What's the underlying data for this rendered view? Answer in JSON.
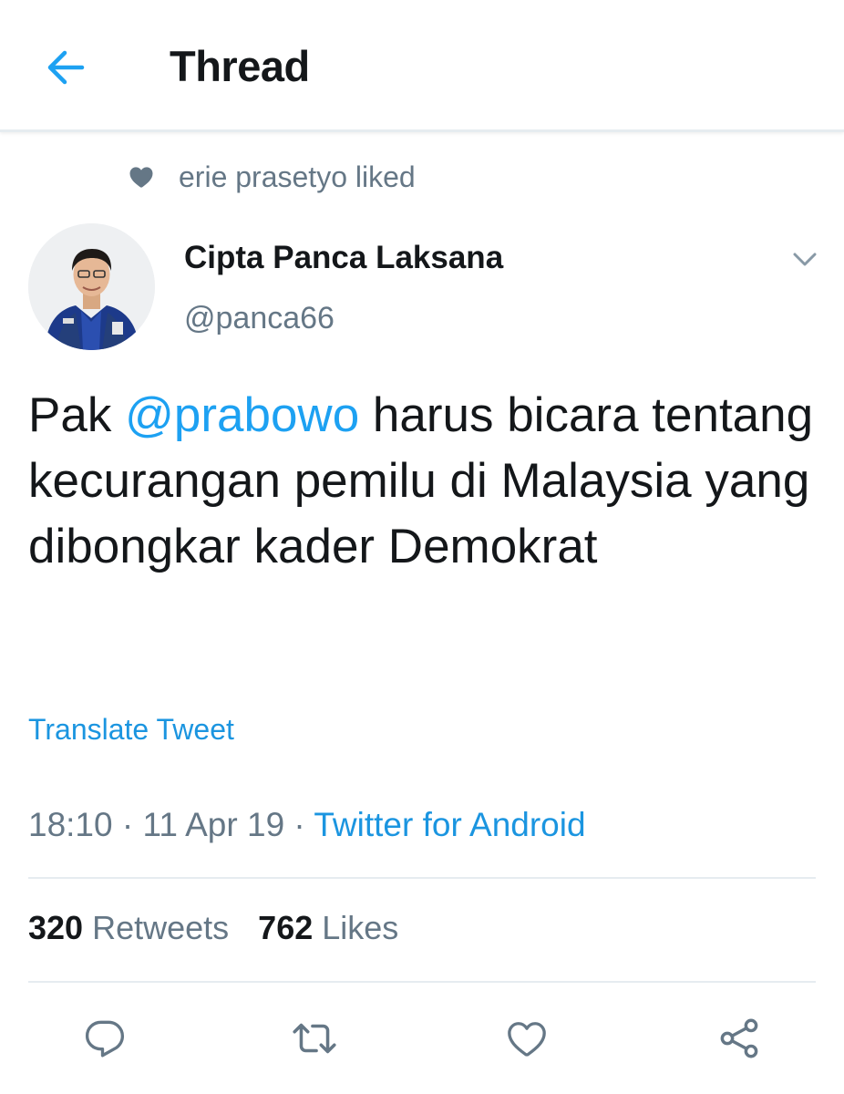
{
  "header": {
    "title": "Thread",
    "back_icon": "arrow-left-icon"
  },
  "social_context": {
    "text": "erie prasetyo liked",
    "icon": "heart-filled-icon"
  },
  "tweet": {
    "author": {
      "display_name": "Cipta Panca Laksana",
      "handle": "@panca66"
    },
    "text_before": "Pak ",
    "mention": "@prabowo",
    "text_after": " harus bicara tentang kecurangan pemilu di Malaysia yang dibongkar kader Demokrat",
    "translate_label": "Translate Tweet",
    "time": "18:10",
    "sep1": " · ",
    "date": "11 Apr 19",
    "sep2": " · ",
    "source": "Twitter for Android",
    "retweets": {
      "count": "320",
      "label": "Retweets"
    },
    "likes": {
      "count": "762",
      "label": "Likes"
    }
  },
  "actions": {
    "reply_icon": "reply-icon",
    "retweet_icon": "retweet-icon",
    "like_icon": "heart-outline-icon",
    "share_icon": "share-icon"
  },
  "colors": {
    "accent": "#1da1f2",
    "link": "#1b95e0",
    "secondary_text": "#657786",
    "primary_text": "#14171a",
    "divider": "#e6ecf0"
  }
}
